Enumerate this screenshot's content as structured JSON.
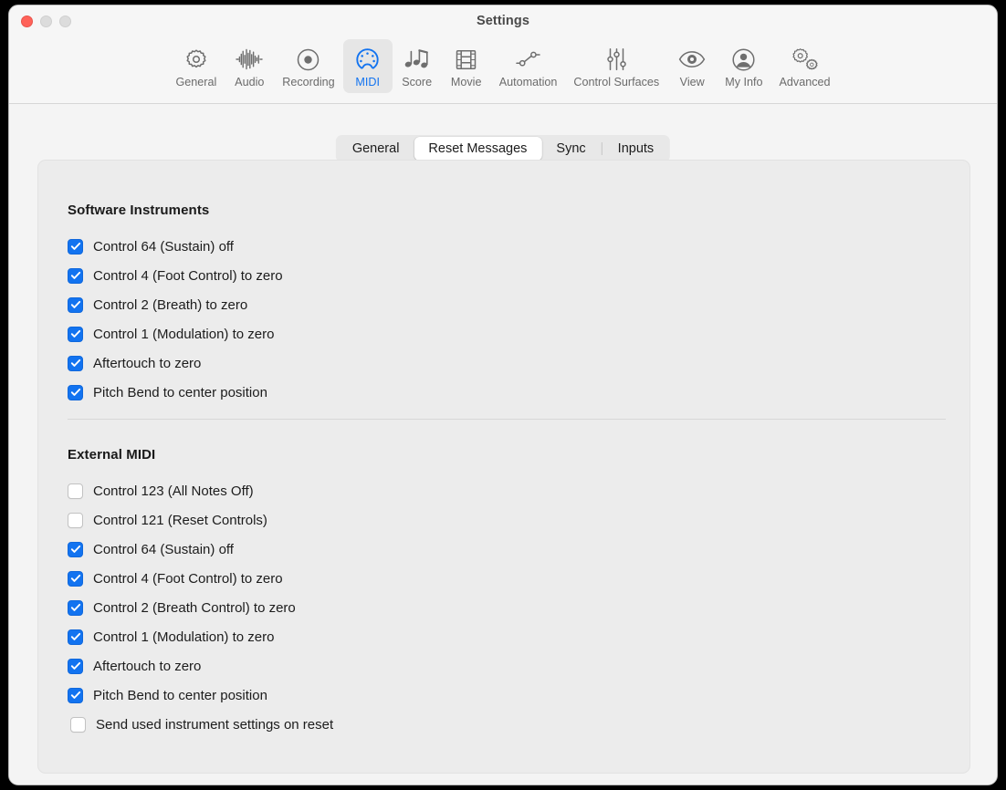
{
  "window": {
    "title": "Settings",
    "traffic_lights": [
      "close",
      "minimize",
      "maximize"
    ]
  },
  "toolbar": {
    "items": [
      {
        "label": "General",
        "icon": "gear-icon",
        "selected": false
      },
      {
        "label": "Audio",
        "icon": "waveform-icon",
        "selected": false
      },
      {
        "label": "Recording",
        "icon": "record-circle-icon",
        "selected": false
      },
      {
        "label": "MIDI",
        "icon": "midi-connector-icon",
        "selected": true
      },
      {
        "label": "Score",
        "icon": "music-notes-icon",
        "selected": false
      },
      {
        "label": "Movie",
        "icon": "film-strip-icon",
        "selected": false
      },
      {
        "label": "Automation",
        "icon": "automation-node-icon",
        "selected": false
      },
      {
        "label": "Control Surfaces",
        "icon": "sliders-icon",
        "selected": false
      },
      {
        "label": "View",
        "icon": "eye-icon",
        "selected": false
      },
      {
        "label": "My Info",
        "icon": "person-circle-icon",
        "selected": false
      },
      {
        "label": "Advanced",
        "icon": "double-gear-icon",
        "selected": false
      }
    ]
  },
  "tabs": {
    "items": [
      {
        "label": "General",
        "active": false,
        "divider_before": false
      },
      {
        "label": "Reset Messages",
        "active": true,
        "divider_before": false
      },
      {
        "label": "Sync",
        "active": false,
        "divider_before": false
      },
      {
        "label": "Inputs",
        "active": false,
        "divider_before": true
      }
    ]
  },
  "sections": [
    {
      "title": "Software Instruments",
      "items": [
        {
          "label": "Control 64 (Sustain) off",
          "checked": true,
          "indent": false
        },
        {
          "label": "Control 4 (Foot Control) to zero",
          "checked": true,
          "indent": false
        },
        {
          "label": "Control 2 (Breath) to zero",
          "checked": true,
          "indent": false
        },
        {
          "label": "Control 1 (Modulation) to zero",
          "checked": true,
          "indent": false
        },
        {
          "label": "Aftertouch to zero",
          "checked": true,
          "indent": false
        },
        {
          "label": "Pitch Bend to center position",
          "checked": true,
          "indent": false
        }
      ]
    },
    {
      "title": "External MIDI",
      "items": [
        {
          "label": "Control 123 (All Notes Off)",
          "checked": false,
          "indent": false
        },
        {
          "label": "Control 121 (Reset Controls)",
          "checked": false,
          "indent": false
        },
        {
          "label": "Control 64 (Sustain) off",
          "checked": true,
          "indent": false
        },
        {
          "label": "Control 4 (Foot Control) to zero",
          "checked": true,
          "indent": false
        },
        {
          "label": "Control 2 (Breath Control) to zero",
          "checked": true,
          "indent": false
        },
        {
          "label": "Control 1 (Modulation) to zero",
          "checked": true,
          "indent": false
        },
        {
          "label": "Aftertouch to zero",
          "checked": true,
          "indent": false
        },
        {
          "label": "Pitch Bend to center position",
          "checked": true,
          "indent": false
        },
        {
          "label": "Send used instrument settings on reset",
          "checked": false,
          "indent": true
        }
      ]
    }
  ],
  "colors": {
    "accent": "#1273f0",
    "window_bg": "#f2f2f2",
    "panel_bg": "#ececec",
    "text": "#1c1c1c",
    "close_button": "#ff6259"
  }
}
